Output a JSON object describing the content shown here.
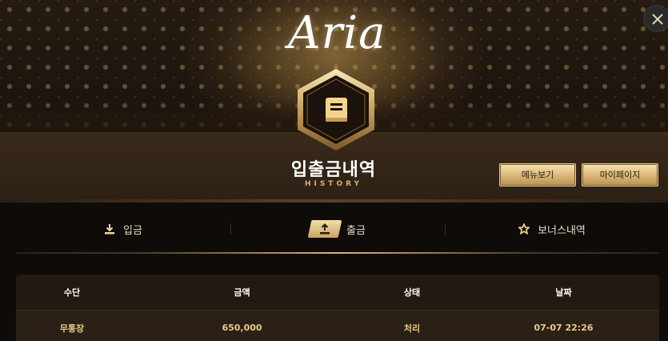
{
  "brand": {
    "logo_text": "Aria"
  },
  "page": {
    "title": "입출금내역",
    "subtitle": "HISTORY"
  },
  "header_buttons": {
    "menu_label": "메뉴보기",
    "mypage_label": "마이페이지"
  },
  "tabs": [
    {
      "label": "입금",
      "icon": "download-icon",
      "active": false
    },
    {
      "label": "출금",
      "icon": "upload-icon",
      "active": true
    },
    {
      "label": "보너스내역",
      "icon": "star-icon",
      "active": false
    }
  ],
  "table": {
    "headers": [
      "수단",
      "금액",
      "상태",
      "날짜"
    ],
    "rows": [
      [
        "무통장",
        "650,000",
        "처리",
        "07-07 22:26"
      ]
    ]
  },
  "colors": {
    "accent_gold": "#d8b576",
    "background": "#0f0b08",
    "panel": "#221a12"
  },
  "icons": {
    "close": "close-icon",
    "book": "book-icon"
  }
}
